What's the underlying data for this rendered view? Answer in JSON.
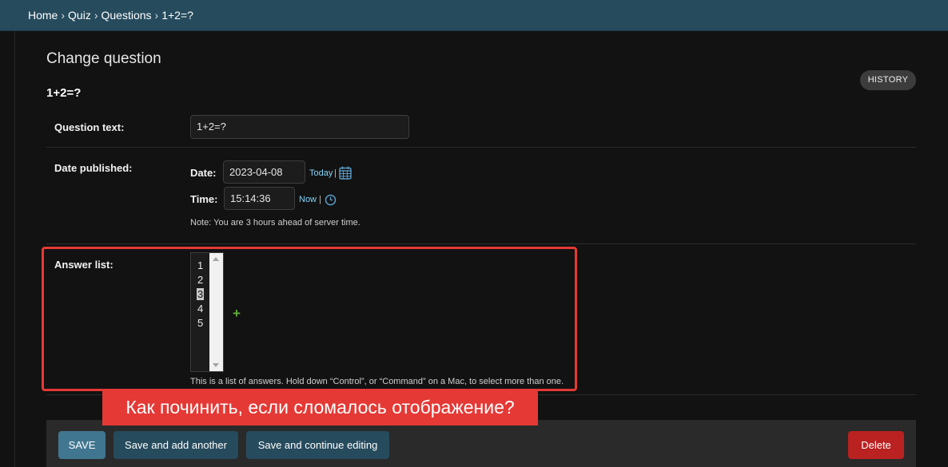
{
  "header": {
    "breadcrumb": [
      "Home",
      "Quiz",
      "Questions",
      "1+2=?"
    ],
    "separator": "›"
  },
  "page": {
    "title": "Change question",
    "object_title": "1+2=?",
    "history_label": "HISTORY"
  },
  "form": {
    "question_text": {
      "label": "Question text:",
      "value": "1+2=?"
    },
    "date_published": {
      "label": "Date published:",
      "date_label": "Date:",
      "date_value": "2023-04-08",
      "today_link": "Today",
      "time_label": "Time:",
      "time_value": "15:14:36",
      "now_link": "Now",
      "pipe": "|",
      "note": "Note: You are 3 hours ahead of server time."
    },
    "answer_list": {
      "label": "Answer list:",
      "options": [
        "1",
        "2",
        "3",
        "4",
        "5"
      ],
      "selected": "3",
      "add_icon": "+",
      "help": "This is a list of answers. Hold down “Control”, or “Command” on a Mac, to select more than one."
    }
  },
  "overlay": {
    "text": "Как починить, если сломалось отображение?",
    "color": "#e53935"
  },
  "buttons": {
    "save": "SAVE",
    "save_add_another": "Save and add another",
    "save_continue": "Save and continue editing",
    "delete": "Delete"
  },
  "icons": {
    "calendar": "calendar-icon",
    "clock": "clock-icon",
    "add": "plus-icon"
  },
  "colors": {
    "header_bg": "#264b5d",
    "link": "#81d4fa",
    "save_bg": "#417690",
    "delete_bg": "#ba2121",
    "add_icon": "#5fae3a"
  }
}
